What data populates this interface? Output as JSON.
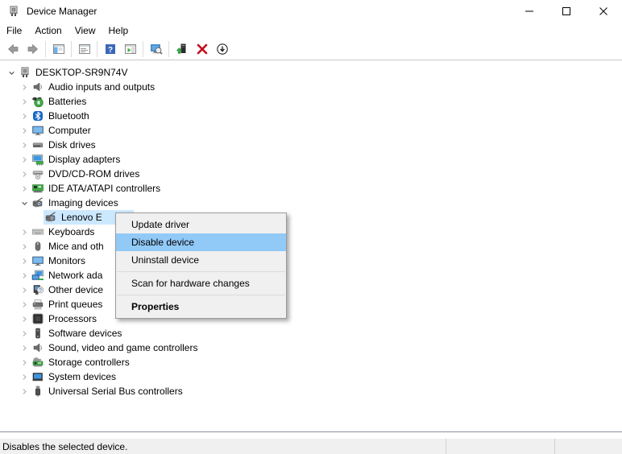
{
  "window": {
    "title": "Device Manager"
  },
  "menu_bar": [
    "File",
    "Action",
    "View",
    "Help"
  ],
  "toolbar": {
    "groups": [
      [
        "back-arrow-icon",
        "forward-arrow-icon"
      ],
      [
        "console-tree-icon"
      ],
      [
        "properties-icon"
      ],
      [
        "help-icon",
        "action-pane-icon"
      ],
      [
        "scan-hardware-icon"
      ],
      [
        "update-driver-icon",
        "uninstall-icon",
        "disable-icon"
      ]
    ]
  },
  "tree": [
    {
      "label": "DESKTOP-SR9N74V",
      "level": 0,
      "state": "expanded",
      "icon": "computer-device-icon",
      "selected": false
    },
    {
      "label": "Audio inputs and outputs",
      "level": 1,
      "state": "collapsed",
      "icon": "audio-icon",
      "selected": false
    },
    {
      "label": "Batteries",
      "level": 1,
      "state": "collapsed",
      "icon": "battery-icon",
      "selected": false
    },
    {
      "label": "Bluetooth",
      "level": 1,
      "state": "collapsed",
      "icon": "bluetooth-icon",
      "selected": false
    },
    {
      "label": "Computer",
      "level": 1,
      "state": "collapsed",
      "icon": "monitor-icon",
      "selected": false
    },
    {
      "label": "Disk drives",
      "level": 1,
      "state": "collapsed",
      "icon": "disk-drive-icon",
      "selected": false
    },
    {
      "label": "Display adapters",
      "level": 1,
      "state": "collapsed",
      "icon": "display-adapter-icon",
      "selected": false
    },
    {
      "label": "DVD/CD-ROM drives",
      "level": 1,
      "state": "collapsed",
      "icon": "dvd-drive-icon",
      "selected": false
    },
    {
      "label": "IDE ATA/ATAPI controllers",
      "level": 1,
      "state": "collapsed",
      "icon": "ide-controller-icon",
      "selected": false
    },
    {
      "label": "Imaging devices",
      "level": 1,
      "state": "expanded",
      "icon": "imaging-device-icon",
      "selected": false
    },
    {
      "label": "Lenovo E",
      "level": 2,
      "state": "leaf",
      "icon": "imaging-device-icon",
      "selected": true
    },
    {
      "label": "Keyboards",
      "level": 1,
      "state": "collapsed",
      "icon": "keyboard-icon",
      "selected": false
    },
    {
      "label": "Mice and oth",
      "level": 1,
      "state": "collapsed",
      "icon": "mouse-icon",
      "selected": false
    },
    {
      "label": "Monitors",
      "level": 1,
      "state": "collapsed",
      "icon": "monitor-icon",
      "selected": false
    },
    {
      "label": "Network ada",
      "level": 1,
      "state": "collapsed",
      "icon": "network-adapter-icon",
      "selected": false
    },
    {
      "label": "Other device",
      "level": 1,
      "state": "collapsed",
      "icon": "unknown-device-icon",
      "selected": false
    },
    {
      "label": "Print queues",
      "level": 1,
      "state": "collapsed",
      "icon": "printer-icon",
      "selected": false
    },
    {
      "label": "Processors",
      "level": 1,
      "state": "collapsed",
      "icon": "processor-icon",
      "selected": false
    },
    {
      "label": "Software devices",
      "level": 1,
      "state": "collapsed",
      "icon": "software-device-icon",
      "selected": false
    },
    {
      "label": "Sound, video and game controllers",
      "level": 1,
      "state": "collapsed",
      "icon": "sound-icon",
      "selected": false
    },
    {
      "label": "Storage controllers",
      "level": 1,
      "state": "collapsed",
      "icon": "storage-controller-icon",
      "selected": false
    },
    {
      "label": "System devices",
      "level": 1,
      "state": "collapsed",
      "icon": "system-device-icon",
      "selected": false
    },
    {
      "label": "Universal Serial Bus controllers",
      "level": 1,
      "state": "collapsed",
      "icon": "usb-icon",
      "selected": false
    }
  ],
  "context_menu": {
    "items": [
      {
        "label": "Update driver"
      },
      {
        "label": "Disable device",
        "highlighted": true
      },
      {
        "label": "Uninstall device"
      },
      {
        "separator": true
      },
      {
        "label": "Scan for hardware changes"
      },
      {
        "separator": true
      },
      {
        "label": "Properties",
        "bold": true
      }
    ]
  },
  "status_bar": {
    "text": "Disables the selected device."
  },
  "colors": {
    "tree_selection": "#cce8ff",
    "menu_highlight": "#91c9f7",
    "uninstall_red": "#c50f1f",
    "accent_blue": "#3e95e0",
    "green": "#3faf46"
  }
}
